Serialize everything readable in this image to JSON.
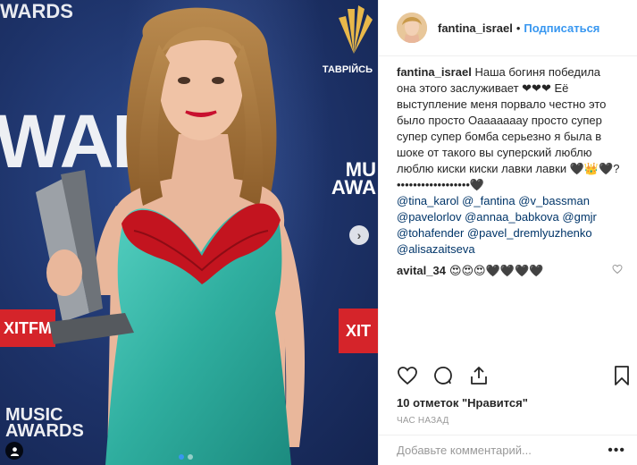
{
  "photo": {
    "bg_awards": "WARD",
    "bg_wards_top": "WARDS",
    "bg_music_line1": "MUSIC",
    "bg_music_line2": "AWARDS",
    "xit_left": "XITFM",
    "xit_right": "XIT",
    "taurida": "ТАВРІЙСЬ",
    "m_logo_right_1": "MU",
    "m_logo_right_2": "AWA",
    "carousel_next": "›"
  },
  "header": {
    "username": "fantina_israel",
    "separator": "•",
    "follow_label": "Подписаться"
  },
  "caption": {
    "username": "fantina_israel",
    "text": "Наша богиня победила она этого заслуживает ❤❤❤ Её выступление меня порвало честно это было просто Оааааааау просто супер супер супер бомба серьезно я была в шоке от такого вы суперский люблю люблю киски киски лавки лавки 🖤👑🖤?••••••••••••••••••🖤",
    "tags": "@tina_karol @_fantina @v_bassman @pavelorlov @annaa_babkova @gmjr @tohafender @pavel_dremlyuzhenko @alisazaitseva"
  },
  "comment": {
    "username": "avital_34",
    "text": "😍😍😍🖤🖤🖤🖤"
  },
  "footer": {
    "likes": "10 отметок \"Нравится\"",
    "time": "час назад",
    "add_comment_placeholder": "Добавьте комментарий...",
    "more": "•••"
  },
  "colors": {
    "link_blue": "#3897f0",
    "tag_blue": "#003569",
    "dress": "#3fbfb0",
    "lace": "#c3141f",
    "backdrop": "#1d3268"
  }
}
